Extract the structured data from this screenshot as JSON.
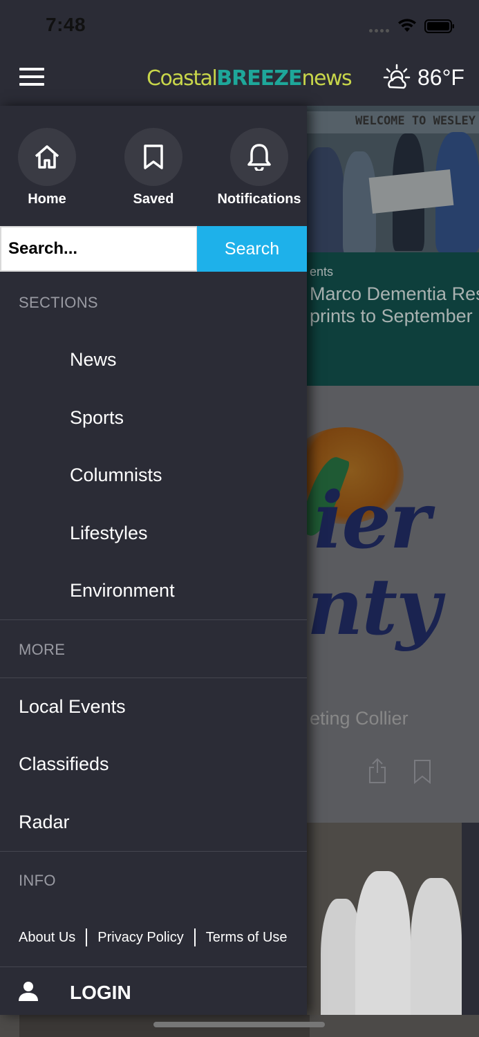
{
  "status_bar": {
    "time": "7:48"
  },
  "header": {
    "logo": {
      "part1": "Coastal",
      "part2": "BREEZE",
      "part3": "news"
    },
    "weather": {
      "icon": "partly-sunny-icon",
      "temperature": "86°F"
    }
  },
  "drawer": {
    "quick_links": [
      {
        "label": "Home",
        "icon": "home-icon"
      },
      {
        "label": "Saved",
        "icon": "bookmark-icon"
      },
      {
        "label": "Notifications",
        "icon": "bell-icon"
      }
    ],
    "search": {
      "placeholder": "Search...",
      "button_label": "Search"
    },
    "sections": {
      "heading": "SECTIONS",
      "items": [
        "News",
        "Sports",
        "Columnists",
        "Lifestyles",
        "Environment"
      ]
    },
    "more": {
      "heading": "MORE",
      "items": [
        "Local Events",
        "Classifieds",
        "Radar"
      ]
    },
    "info": {
      "heading": "INFO",
      "links": [
        "About Us",
        "Privacy Policy",
        "Terms of Use"
      ]
    },
    "login": {
      "label": "LOGIN",
      "icon": "user-icon"
    }
  },
  "background_content": {
    "banner_text": "WELCOME TO WESLEY",
    "category": "ents",
    "headline_line1": "Marco Dementia Resp",
    "headline_line2": "prints to September L",
    "logo_text_line1": "ier",
    "logo_text_line2": "nty",
    "caption": "eting Collier"
  },
  "colors": {
    "drawer_bg": "#2b2c36",
    "search_button": "#1eb1ea",
    "logo_green": "#c8d64a",
    "logo_teal": "#1ea79a",
    "teal_card": "#0e3f3c"
  }
}
